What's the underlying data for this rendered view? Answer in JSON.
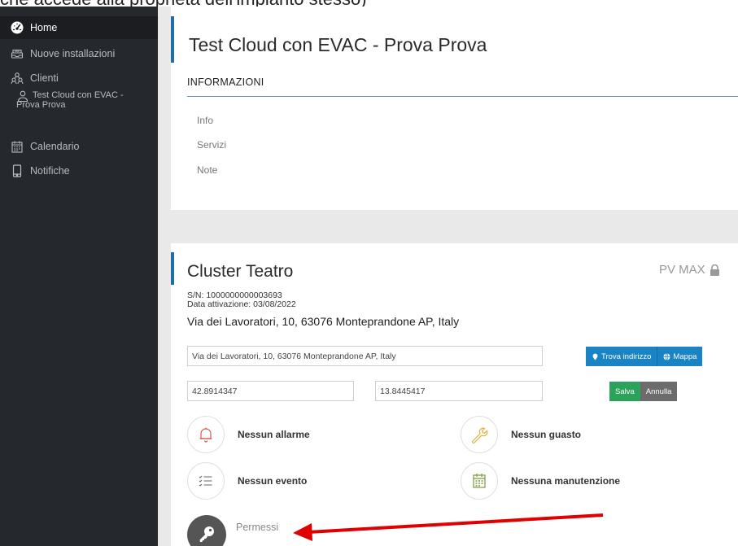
{
  "top_strip_text": "che accede alla proprietà dell'impianto stesso)",
  "sidebar": {
    "items": [
      {
        "label": "Home",
        "icon": "dashboard-icon"
      },
      {
        "label": "Nuove installazioni",
        "icon": "inbox-icon"
      },
      {
        "label": "Clienti",
        "icon": "users-icon"
      },
      {
        "label": "Calendario",
        "icon": "calendar-icon"
      },
      {
        "label": "Notifiche",
        "icon": "mobile-icon"
      }
    ],
    "sub_item": {
      "line1": "Test Cloud con EVAC -",
      "line2": "Prova Prova",
      "icon": "user-icon"
    }
  },
  "info_card": {
    "title": "Test Cloud con EVAC - Prova Prova",
    "tab": "INFORMAZIONI",
    "menu": [
      "Info",
      "Servizi",
      "Note"
    ]
  },
  "cluster_card": {
    "title": "Cluster Teatro",
    "pv_label": "PV MAX",
    "serial": "S/N: 1000000000003693",
    "activation": "Data attivazione: 03/08/2022",
    "address": "Via dei Lavoratori, 10, 63076 Monteprandone AP, Italy",
    "address_field": "Via dei Lavoratori, 10, 63076 Monteprandone AP, Italy",
    "latitude": "42.8914347",
    "longitude": "13.8445417",
    "buttons": {
      "find_address": "Trova indirizzo",
      "map": "Mappa",
      "save": "Salva",
      "cancel": "Annulla"
    },
    "stats": {
      "alarms": "Nessun allarme",
      "faults": "Nessun guasto",
      "events": "Nessun evento",
      "maintenance": "Nessuna manutenzione"
    },
    "permissions": "Permessi"
  },
  "colors": {
    "sidebar_bg": "#25282d",
    "accent": "#1f6fa4",
    "alarm_red": "#d9534f",
    "fault_gold": "#e0b13a",
    "annotation_arrow": "#e00000"
  }
}
